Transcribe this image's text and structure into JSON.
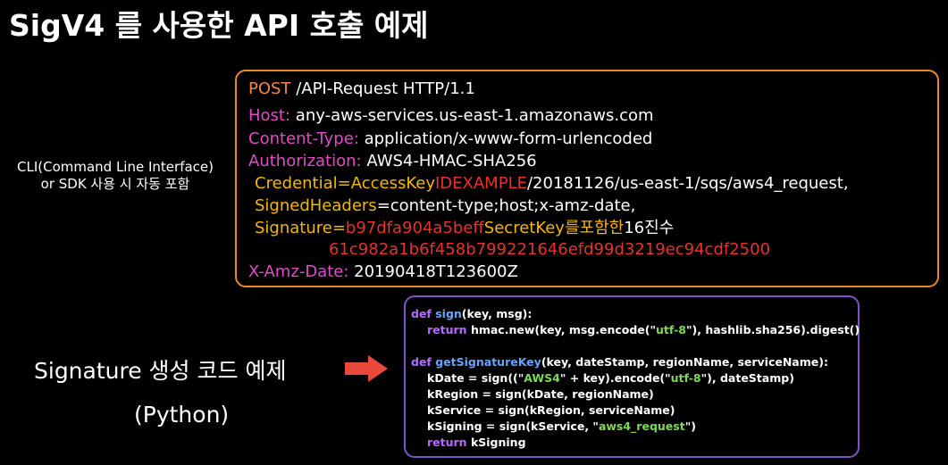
{
  "title": "SigV4 를 사용한 API 호출 예제",
  "side_note": [
    "CLI(Command Line Interface)",
    "or SDK 사용 시 자동 포함"
  ],
  "http_request": {
    "method": "POST",
    "request_line_rest": "/API-Request HTTP/1.1",
    "host_key": "Host:",
    "host_value": "any-aws-services.us-east-1.amazonaws.com",
    "content_type_key": "Content-Type:",
    "content_type_value": "application/x-www-form-urlencoded",
    "authorization_key": "Authorization:",
    "authorization_value": "AWS4-HMAC-SHA256",
    "credential_key": "Credential=",
    "credential_access_key": "AccessKey",
    "credential_id": "IDEXAMPLE",
    "credential_scope": "/20181126/us-east-1/sqs/aws4_request,",
    "signed_headers_key": "SignedHeaders",
    "signed_headers_value": "=content-type;host;x-amz-date,",
    "signature_key": "Signature=",
    "signature_part1": "b97dfa904a5beff",
    "signature_note": "SecretKey를포함한",
    "signature_note2": "16진수",
    "signature_part2": "61c982a1b6f458b799221646efd99d3219ec94cdf2500",
    "date_key": "X-Amz-Date:",
    "date_value": "20190418T123600Z"
  },
  "signature_label": "Signature 생성 코드 예제",
  "signature_sublabel": "(Python)",
  "code": {
    "l1_def": "def ",
    "l1_name": "sign",
    "l1_rest": "(key, msg):",
    "l2_ret": "return ",
    "l2_a": "hmac.new(key, msg.encode(\"",
    "l2_str": "utf-8",
    "l2_b": "\"), hashlib.sha256).digest()",
    "l4_def": "def ",
    "l4_name": "getSignatureKey",
    "l4_rest": "(key, dateStamp, regionName, serviceName):",
    "l5_a": "kDate = sign((\"",
    "l5_str": "AWS4",
    "l5_b": "\" + key).encode(\"",
    "l5_str2": "utf-8",
    "l5_c": "\"), dateStamp)",
    "l6": "kRegion = sign(kDate, regionName)",
    "l7": "kService = sign(kRegion, serviceName)",
    "l8_a": "kSigning = sign(kService, \"",
    "l8_str": "aws4_request",
    "l8_b": "\")",
    "l9_ret": "return ",
    "l9_rest": "kSigning"
  },
  "colors": {
    "http_box_border": "#e8892b",
    "code_box_border": "#7b54c9",
    "arrow": "#e8493a"
  },
  "icons": {
    "arrow": "right-arrow-icon"
  }
}
